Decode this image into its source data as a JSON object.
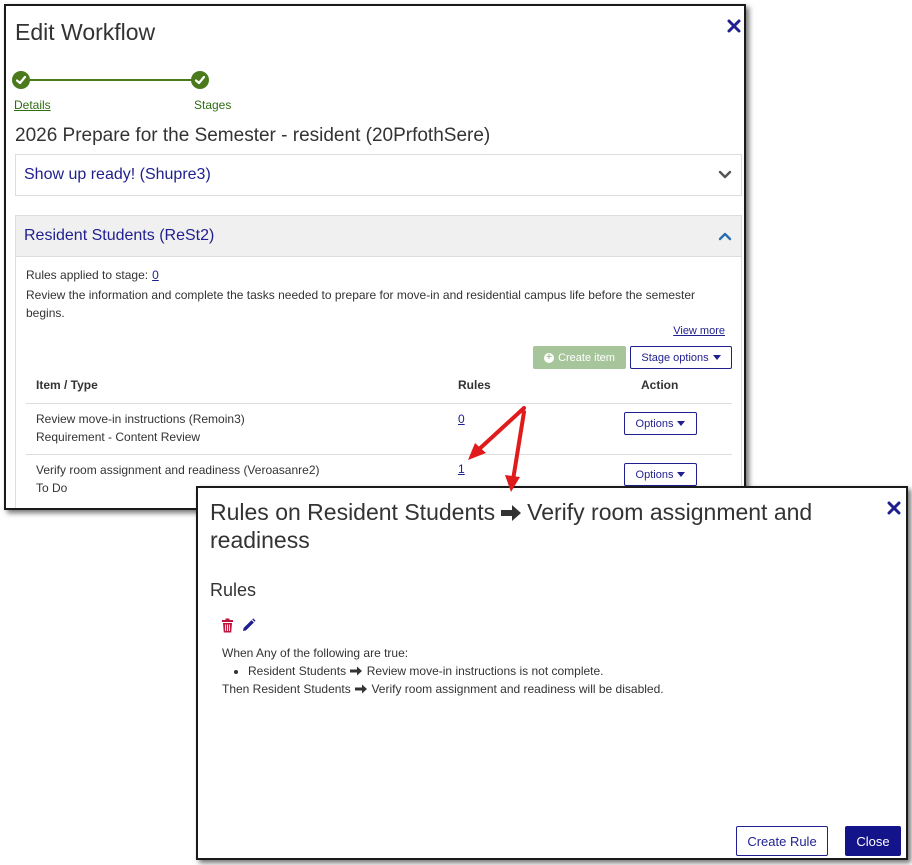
{
  "edit_workflow": {
    "title": "Edit Workflow",
    "steps": [
      {
        "label": "Details",
        "completed": true
      },
      {
        "label": "Stages",
        "completed": true
      }
    ],
    "workflow_title": "2026 Prepare for the Semester - resident (20PrfothSere)",
    "panels": [
      {
        "title": "Show up ready! (Shupre3)",
        "expanded": false
      },
      {
        "title": "Resident Students (ReSt2)",
        "expanded": true
      }
    ],
    "stage": {
      "rules_applied_label": "Rules applied to stage:",
      "rules_applied_count": "0",
      "description": "Review the information and complete the tasks needed to prepare for move-in and residential campus life before the semester begins.",
      "view_more": "View more",
      "create_item": "Create item",
      "stage_options": "Stage options",
      "columns": {
        "item": "Item / Type",
        "rules": "Rules",
        "action": "Action"
      },
      "rows": [
        {
          "name": "Review move-in instructions (Remoin3)",
          "type": "Requirement - Content Review",
          "rules": "0",
          "action": "Options"
        },
        {
          "name": "Verify room assignment and readiness (Veroasanre2)",
          "type": "To Do",
          "rules": "1",
          "action": "Options"
        }
      ]
    }
  },
  "rules_dialog": {
    "title_part1": "Rules on Resident Students",
    "title_part2": "Verify room assignment and readiness",
    "section_heading": "Rules",
    "condition_intro": "When Any of the following are true:",
    "condition_stage": "Resident Students",
    "condition_item": "Review move-in instructions is not complete.",
    "result_prefix": "Then Resident Students",
    "result_item": "Verify room assignment and readiness will be disabled.",
    "create_rule": "Create Rule",
    "close": "Close"
  },
  "colors": {
    "accent_navy": "#1f1f8f",
    "step_green": "#4b7a1c",
    "delete_red": "#c0143c",
    "annotation_red": "#e01b1b"
  }
}
